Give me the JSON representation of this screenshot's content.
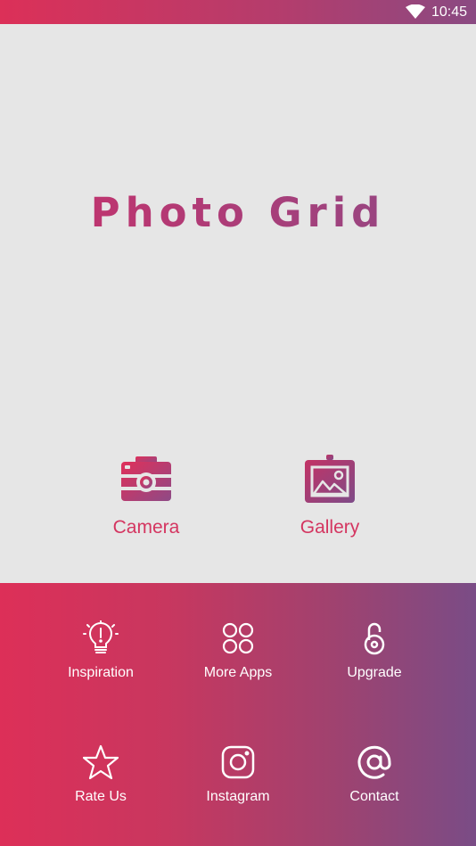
{
  "status": {
    "time": "10:45",
    "wifi_icon": "wifi-icon"
  },
  "app": {
    "title": "Photo Grid"
  },
  "actions": [
    {
      "label": "Camera",
      "icon": "camera-icon"
    },
    {
      "label": "Gallery",
      "icon": "gallery-icon"
    }
  ],
  "menu": [
    {
      "label": "Inspiration",
      "icon": "lightbulb-icon"
    },
    {
      "label": "More Apps",
      "icon": "apps-grid-icon"
    },
    {
      "label": "Upgrade",
      "icon": "unlock-icon"
    },
    {
      "label": "Rate Us",
      "icon": "star-icon"
    },
    {
      "label": "Instagram",
      "icon": "instagram-icon"
    },
    {
      "label": "Contact",
      "icon": "at-sign-icon"
    }
  ],
  "colors": {
    "accent": "#dc3058",
    "accent_end": "#7a4c86",
    "background": "#e6e6e6"
  }
}
